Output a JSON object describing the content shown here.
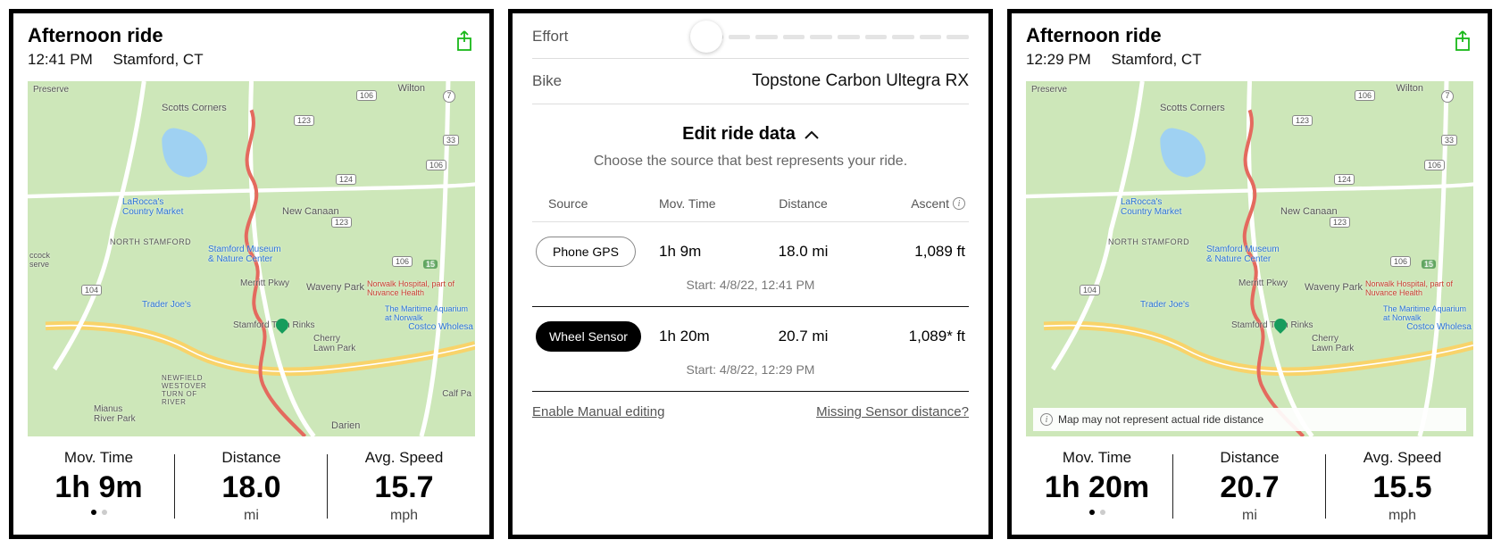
{
  "left": {
    "title": "Afternoon ride",
    "time": "12:41 PM",
    "location": "Stamford, CT",
    "stats": {
      "mov_time_label": "Mov. Time",
      "mov_time": "1h 9m",
      "distance_label": "Distance",
      "distance": "18.0",
      "distance_unit": "mi",
      "speed_label": "Avg. Speed",
      "speed": "15.7",
      "speed_unit": "mph"
    }
  },
  "mid": {
    "effort_label": "Effort",
    "bike_label": "Bike",
    "bike_value": "Topstone Carbon Ultegra RX",
    "edit_header": "Edit ride data",
    "subtext": "Choose the source that best represents your ride.",
    "cols": {
      "c1": "Source",
      "c2": "Mov. Time",
      "c3": "Distance",
      "c4": "Ascent"
    },
    "rows": [
      {
        "source": "Phone GPS",
        "mov": "1h 9m",
        "dist": "18.0 mi",
        "asc": "1,089 ft",
        "start": "Start: 4/8/22, 12:41 PM",
        "selected": false
      },
      {
        "source": "Wheel Sensor",
        "mov": "1h 20m",
        "dist": "20.7 mi",
        "asc": "1,089* ft",
        "start": "Start: 4/8/22, 12:29 PM",
        "selected": true
      }
    ],
    "link_left": "Enable Manual editing",
    "link_right": "Missing Sensor distance?"
  },
  "right": {
    "title": "Afternoon ride",
    "time": "12:29 PM",
    "location": "Stamford, CT",
    "disclaimer": "Map may not represent actual ride distance",
    "stats": {
      "mov_time_label": "Mov. Time",
      "mov_time": "1h 20m",
      "distance_label": "Distance",
      "distance": "20.7",
      "distance_unit": "mi",
      "speed_label": "Avg. Speed",
      "speed": "15.5",
      "speed_unit": "mph"
    }
  },
  "map_places": {
    "wilton": "Wilton",
    "scotts": "Scotts Corners",
    "preserve": "Preserve",
    "newcanaan": "New Canaan",
    "northstamford": "NORTH STAMFORD",
    "waveny": "Waveny Park",
    "merritt": "Merritt Pkwy",
    "larocca": "LaRocca's Country Market",
    "traderjoes": "Trader Joe's",
    "museum": "Stamford Museum & Nature Center",
    "twinrinks": "Stamford Twin Rinks",
    "cherry": "Cherry Lawn Park",
    "costco": "Costco Wholesa",
    "maritime": "The Maritime Aquarium at Norwalk",
    "norwalk": "Norwalk Hospital, part of Nuvance Health",
    "newfield": "NEWFIELD WESTOVER TURN OF RIVER",
    "mianus": "Mianus River Park",
    "calf": "Calf Pa",
    "darien": "Darien",
    "serve": "ccock serve",
    "r123a": "123",
    "r123b": "123",
    "r106a": "106",
    "r106b": "106",
    "r106c": "106",
    "r104": "104",
    "r15": "15",
    "r124": "124",
    "r7": "7",
    "r33": "33"
  }
}
